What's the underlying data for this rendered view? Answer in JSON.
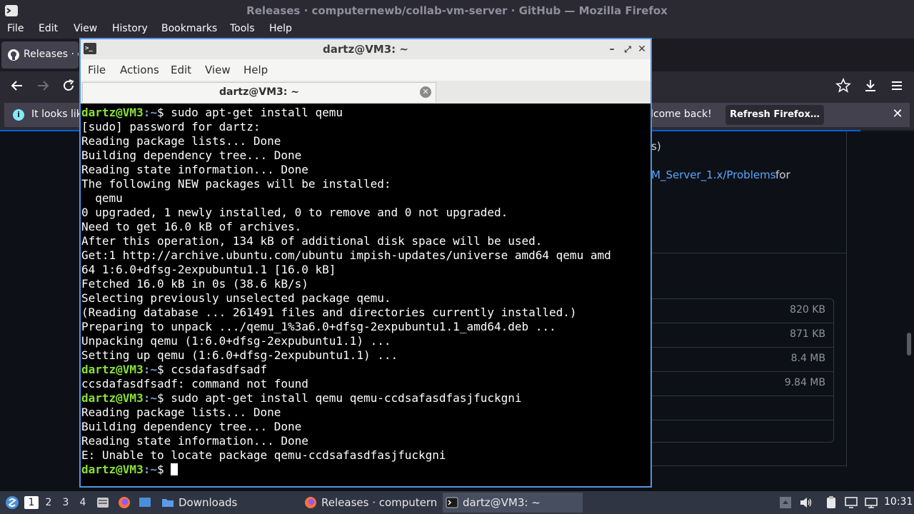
{
  "firefox": {
    "window_title": "Releases · computernewb/collab-vm-server · GitHub — Mozilla Firefox",
    "menu": [
      "File",
      "Edit",
      "View",
      "History",
      "Bookmarks",
      "Tools",
      "Help"
    ],
    "tab_label": "Releases · c",
    "notice_left": "It looks lik",
    "notice_right": "lcome back!",
    "refresh_button": "Refresh Firefox…",
    "page": {
      "text_fragment": "s)",
      "link_fragment": "M_Server_1.x/Problems",
      "link_suffix": "for",
      "asset_sizes": [
        "820 KB",
        "871 KB",
        "8.4 MB",
        "9.84 MB"
      ]
    }
  },
  "terminal": {
    "window_title": "dartz@VM3: ~",
    "menu": [
      "File",
      "Actions",
      "Edit",
      "View",
      "Help"
    ],
    "tab_label": "dartz@VM3: ~",
    "prompt_user": "dartz@VM3",
    "prompt_path": ":~",
    "lines": [
      {
        "type": "prompt",
        "text": "$ sudo apt-get install qemu"
      },
      {
        "type": "output",
        "text": "[sudo] password for dartz:"
      },
      {
        "type": "output",
        "text": "Reading package lists... Done"
      },
      {
        "type": "output",
        "text": "Building dependency tree... Done"
      },
      {
        "type": "output",
        "text": "Reading state information... Done"
      },
      {
        "type": "output",
        "text": "The following NEW packages will be installed:"
      },
      {
        "type": "output",
        "text": "  qemu"
      },
      {
        "type": "output",
        "text": "0 upgraded, 1 newly installed, 0 to remove and 0 not upgraded."
      },
      {
        "type": "output",
        "text": "Need to get 16.0 kB of archives."
      },
      {
        "type": "output",
        "text": "After this operation, 134 kB of additional disk space will be used."
      },
      {
        "type": "output",
        "text": "Get:1 http://archive.ubuntu.com/ubuntu impish-updates/universe amd64 qemu amd"
      },
      {
        "type": "output",
        "text": "64 1:6.0+dfsg-2expubuntu1.1 [16.0 kB]"
      },
      {
        "type": "output",
        "text": "Fetched 16.0 kB in 0s (38.6 kB/s)"
      },
      {
        "type": "output",
        "text": "Selecting previously unselected package qemu."
      },
      {
        "type": "output",
        "text": "(Reading database ... 261491 files and directories currently installed.)"
      },
      {
        "type": "output",
        "text": "Preparing to unpack .../qemu_1%3a6.0+dfsg-2expubuntu1.1_amd64.deb ..."
      },
      {
        "type": "output",
        "text": "Unpacking qemu (1:6.0+dfsg-2expubuntu1.1) ..."
      },
      {
        "type": "output",
        "text": "Setting up qemu (1:6.0+dfsg-2expubuntu1.1) ..."
      },
      {
        "type": "prompt",
        "text": "$ ccsdafasdfsadf"
      },
      {
        "type": "output",
        "text": "ccsdafasdfsadf: command not found"
      },
      {
        "type": "prompt",
        "text": "$ sudo apt-get install qemu qemu-ccdsafasdfasjfuckgni"
      },
      {
        "type": "output",
        "text": "Reading package lists... Done"
      },
      {
        "type": "output",
        "text": "Building dependency tree... Done"
      },
      {
        "type": "output",
        "text": "Reading state information... Done"
      },
      {
        "type": "output",
        "text": "E: Unable to locate package qemu-ccdsafasdfasjfuckgni"
      },
      {
        "type": "prompt_cursor",
        "text": "$ "
      }
    ]
  },
  "taskbar": {
    "workspaces": [
      "1",
      "2",
      "3",
      "4"
    ],
    "tasks": [
      {
        "label": "Downloads",
        "icon": "folder-icon"
      },
      {
        "label": "Releases · computern…",
        "icon": "firefox-icon"
      },
      {
        "label": "dartz@VM3: ~",
        "icon": "terminal-icon"
      }
    ],
    "clock": "10:31"
  }
}
